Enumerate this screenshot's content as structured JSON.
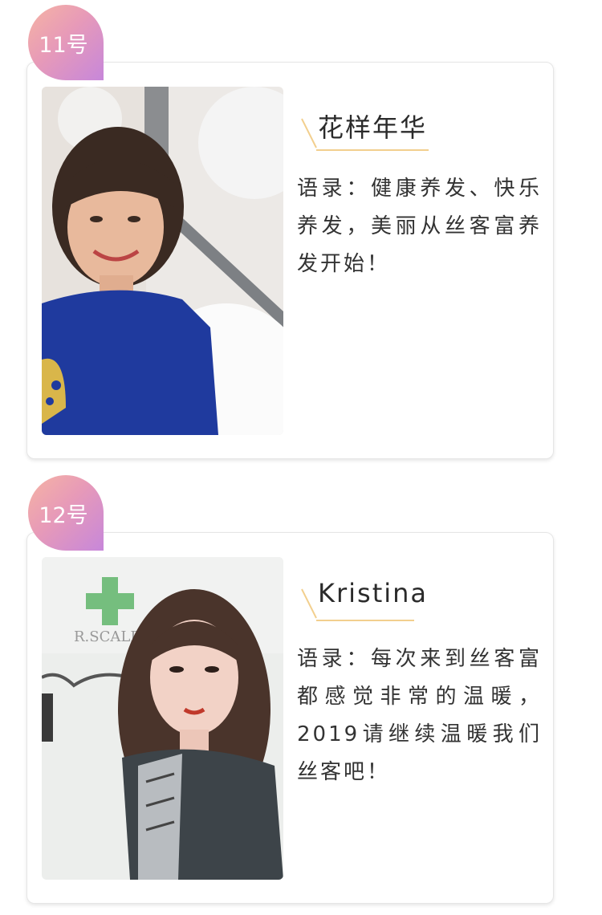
{
  "entries": [
    {
      "badge": "11号",
      "name": "花样年华",
      "quote": "语录：健康养发、快乐养发，美丽从丝客富养发开始！",
      "photo_desc_icon": "portrait-photo"
    },
    {
      "badge": "12号",
      "name": "Kristina",
      "quote": "语录：每次来到丝客富都感觉非常的温暖，2019请继续温暖我们丝客吧！",
      "photo_desc_icon": "portrait-photo"
    }
  ],
  "colors": {
    "badge_gradient_start": "#f6b4a3",
    "badge_gradient_end": "#c787da",
    "accent_line": "#f2cf8e",
    "card_border": "#e6e6e6"
  }
}
